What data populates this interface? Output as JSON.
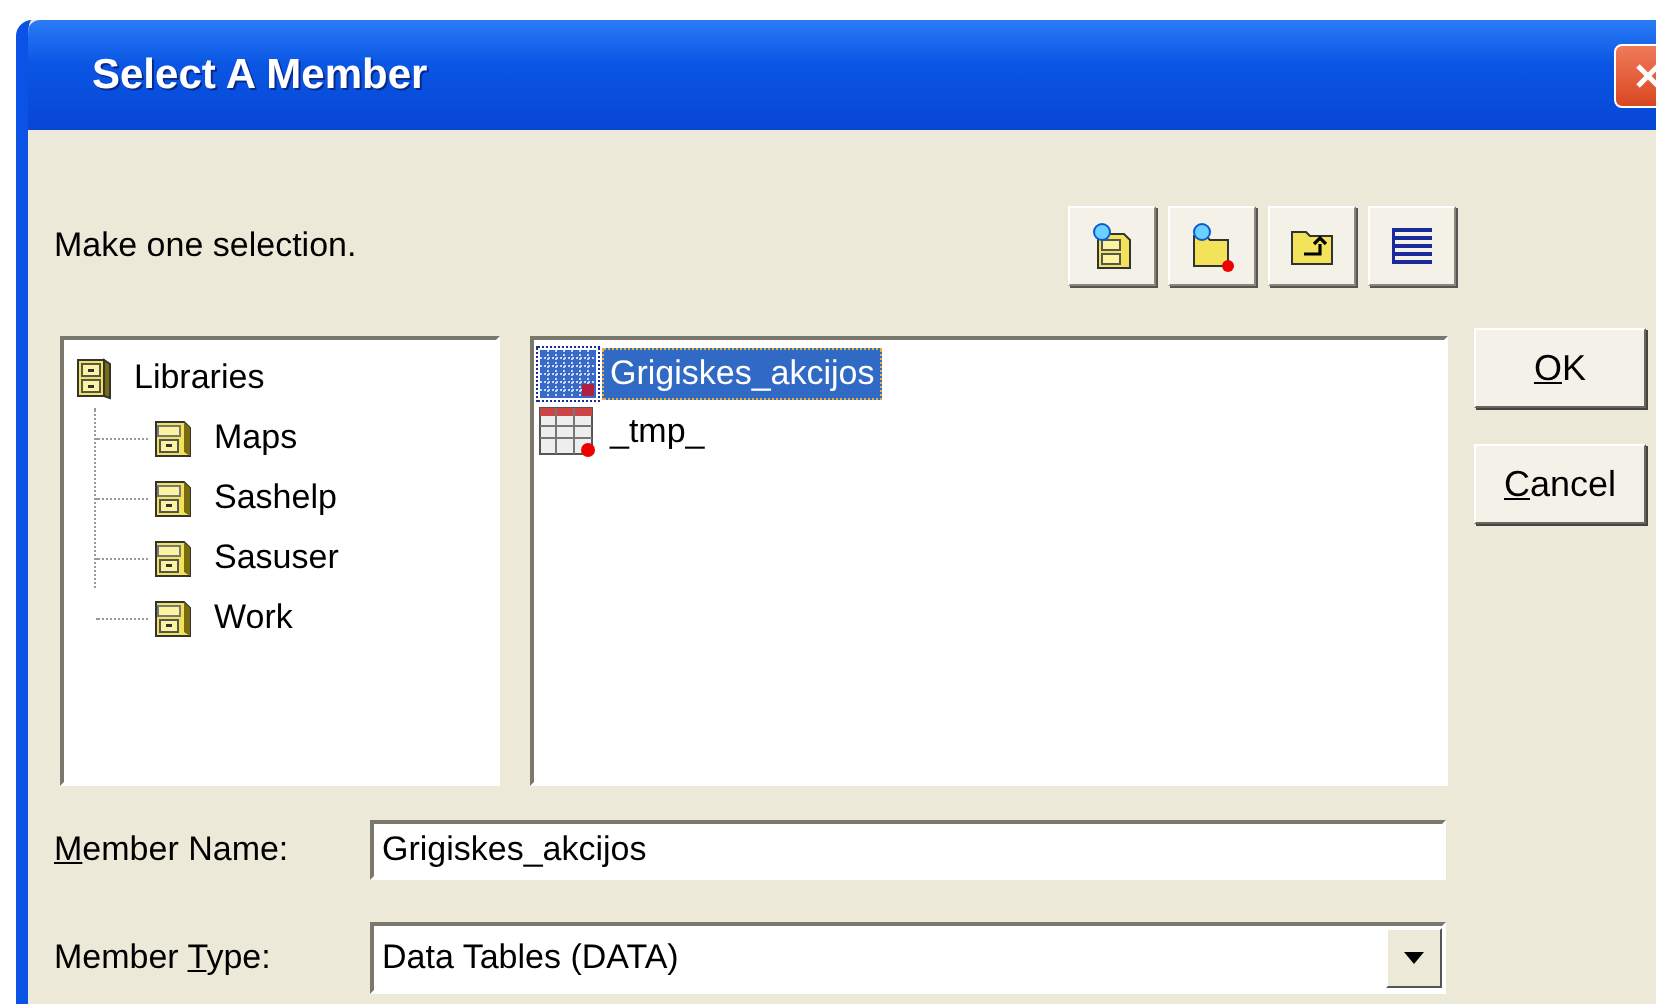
{
  "window": {
    "title": "Select A Member"
  },
  "prompt": "Make one selection.",
  "tree": [
    {
      "label": "Libraries",
      "children": [
        {
          "label": "Maps"
        },
        {
          "label": "Sashelp"
        },
        {
          "label": "Sasuser"
        },
        {
          "label": "Work"
        }
      ]
    }
  ],
  "members": [
    {
      "name": "Grigiskes_akcijos",
      "kind": "view",
      "selected": true
    },
    {
      "name": "_tmp_",
      "kind": "table",
      "selected": false
    }
  ],
  "buttons": [
    {
      "key": "O",
      "after": "K"
    },
    {
      "key": "C",
      "after": "ancel"
    }
  ],
  "member_name": {
    "label": {
      "key": "M",
      "after": "ember Name:"
    },
    "value": "Grigiskes_akcijos"
  },
  "member_type": {
    "label": {
      "before": "Member ",
      "key": "T",
      "after": "ype:"
    },
    "value": "Data Tables (DATA)"
  }
}
